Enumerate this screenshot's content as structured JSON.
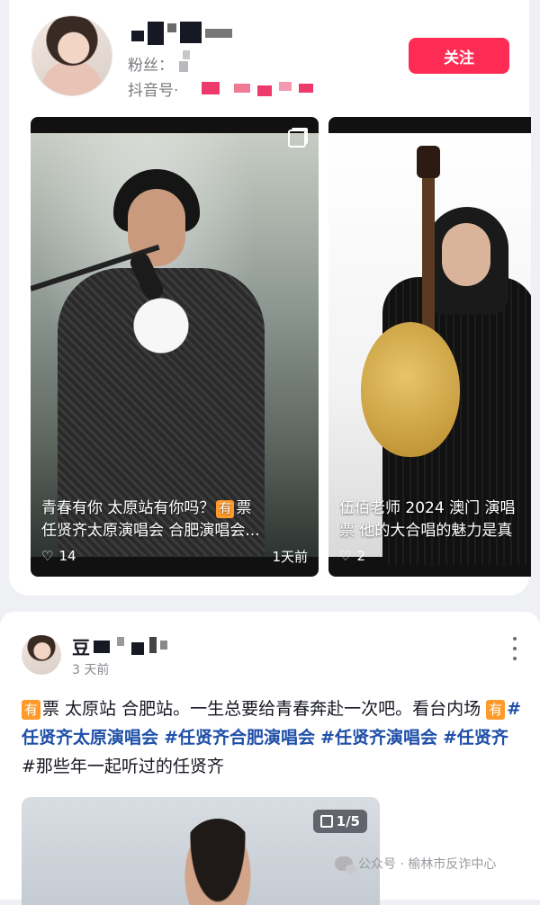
{
  "profile": {
    "fans_label": "粉丝：",
    "douyin_label": "抖音号·",
    "follow_label": "关注"
  },
  "videos": [
    {
      "line1_text": "青春有你 太原站有你吗？",
      "line1_badge": "有",
      "line1_tail": "票",
      "line2_text": "任贤齐太原演唱会 合肥演唱会...",
      "likes": "14",
      "date": "1天前"
    },
    {
      "line1_text": "伍佰老师 2024 澳门 演唱",
      "line2_text": "票 他的大合唱的魅力是真",
      "likes": "2"
    }
  ],
  "post": {
    "author_prefix": "豆",
    "time": "3 天前",
    "badge": "有",
    "text_part1": "票 太原站 合肥站。一生总要给青春奔赴一次吧。看台内场",
    "tag1": "#任贤齐太原演唱会",
    "tag2": "#任贤齐合肥演唱会",
    "tag3": "#任贤齐演唱会",
    "tag4": "#任贤齐",
    "text_part2": "#那些年一起听过的任贤齐",
    "image_counter": "1/5"
  },
  "watermark": {
    "text": "公众号 · 榆林市反诈中心",
    "icon": "wechat-icon"
  },
  "colors": {
    "accent": "#fe2c55",
    "badge": "#fe9a2a",
    "hashtag": "#1f4fa8"
  }
}
